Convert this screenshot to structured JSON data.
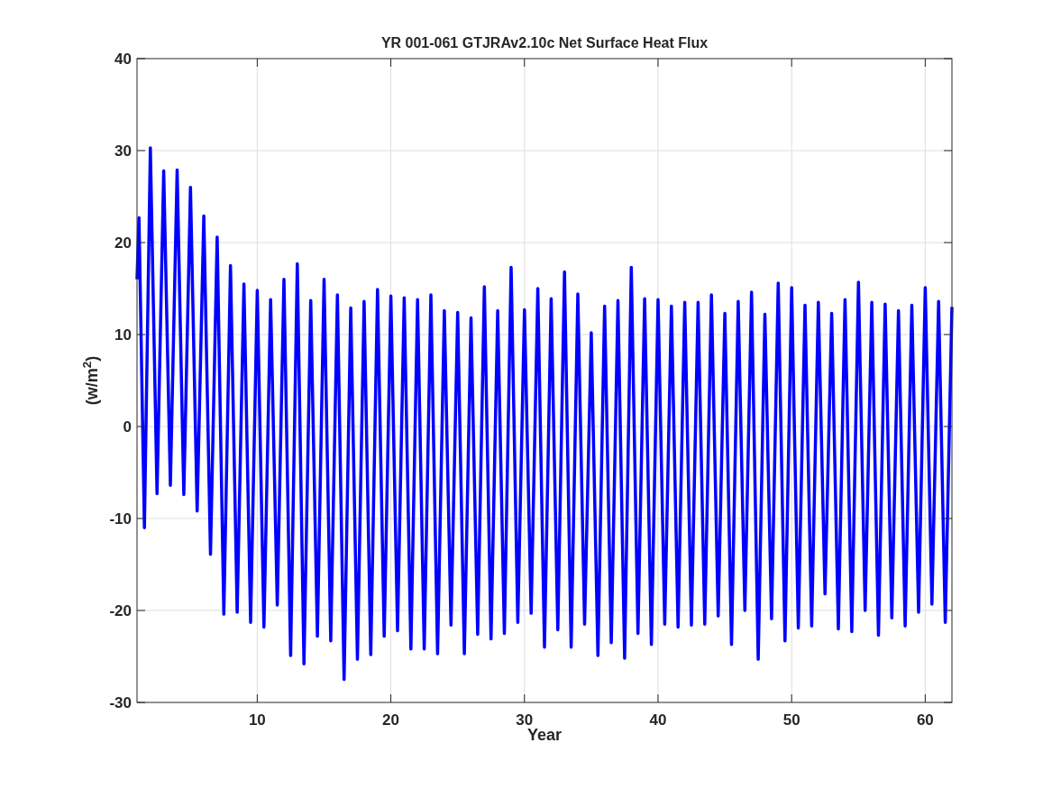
{
  "figure": {
    "chart_data": {
      "type": "line",
      "title": "YR 001-061 GTJRAv2.10c Net Surface Heat Flux",
      "xlabel": "Year",
      "ylabel": "(w/m$^{2}$)",
      "xlim": [
        1,
        62
      ],
      "ylim": [
        -30,
        40
      ],
      "grid": true,
      "xticks": [
        10,
        20,
        30,
        40,
        50,
        60
      ],
      "yticks": [
        -30,
        -20,
        -10,
        0,
        10,
        20,
        30,
        40
      ],
      "x": [
        1,
        1.15,
        1.55,
        2,
        2.5,
        3,
        3.5,
        4,
        4.5,
        5,
        5.5,
        6,
        6.5,
        7,
        7.5,
        8,
        8.5,
        9,
        9.5,
        10,
        10.5,
        11,
        11.5,
        12,
        12.5,
        13,
        13.5,
        14,
        14.5,
        15,
        15.5,
        16,
        16.5,
        17,
        17.5,
        18,
        18.5,
        19,
        19.5,
        20,
        20.5,
        21,
        21.5,
        22,
        22.5,
        23,
        23.5,
        24,
        24.5,
        25,
        25.5,
        26,
        26.5,
        27,
        27.5,
        28,
        28.5,
        29,
        29.5,
        30,
        30.5,
        31,
        31.5,
        32,
        32.5,
        33,
        33.5,
        34,
        34.5,
        35,
        35.5,
        36,
        36.5,
        37,
        37.5,
        38,
        38.5,
        39,
        39.5,
        40,
        40.5,
        41,
        41.5,
        42,
        42.5,
        43,
        43.5,
        44,
        44.5,
        45,
        45.5,
        46,
        46.5,
        47,
        47.5,
        48,
        48.5,
        49,
        49.5,
        50,
        50.5,
        51,
        51.5,
        52,
        52.5,
        53,
        53.5,
        54,
        54.5,
        55,
        55.5,
        56,
        56.5,
        57,
        57.5,
        58,
        58.5,
        59,
        59.5,
        60,
        60.5,
        61,
        61.5,
        62
      ],
      "series": [
        {
          "color": "#0000ff",
          "values": [
            16,
            22.7,
            -11,
            30.3,
            -7.3,
            27.8,
            -6.4,
            27.9,
            -7.4,
            26.0,
            -9.2,
            22.9,
            -13.9,
            20.6,
            -20.4,
            17.5,
            -20.2,
            15.5,
            -21.3,
            14.8,
            -21.8,
            13.8,
            -19.4,
            16.0,
            -24.9,
            17.7,
            -25.8,
            13.7,
            -22.8,
            16.0,
            -23.3,
            14.3,
            -27.5,
            12.9,
            -25.3,
            13.6,
            -24.8,
            14.9,
            -22.8,
            14.2,
            -22.2,
            14.0,
            -24.2,
            13.8,
            -24.2,
            14.3,
            -24.7,
            12.6,
            -21.6,
            12.4,
            -24.7,
            11.8,
            -22.6,
            15.2,
            -23.1,
            12.6,
            -22.5,
            17.3,
            -21.3,
            12.7,
            -20.3,
            15.0,
            -24.0,
            13.9,
            -22.1,
            16.8,
            -24.0,
            14.4,
            -21.5,
            10.2,
            -24.9,
            13.1,
            -23.5,
            13.7,
            -25.2,
            17.3,
            -22.5,
            13.9,
            -23.7,
            13.8,
            -21.5,
            13.1,
            -21.8,
            13.5,
            -21.6,
            13.5,
            -21.5,
            14.3,
            -20.6,
            12.3,
            -23.7,
            13.6,
            -20.0,
            14.6,
            -25.3,
            12.2,
            -20.9,
            15.6,
            -23.3,
            15.1,
            -21.9,
            13.2,
            -21.7,
            13.5,
            -18.2,
            12.3,
            -22.0,
            13.8,
            -22.3,
            15.7,
            -20.0,
            13.5,
            -22.7,
            13.3,
            -20.8,
            12.6,
            -21.7,
            13.2,
            -20.2,
            15.1,
            -19.3,
            13.6,
            -21.3,
            13.0
          ]
        }
      ]
    }
  }
}
